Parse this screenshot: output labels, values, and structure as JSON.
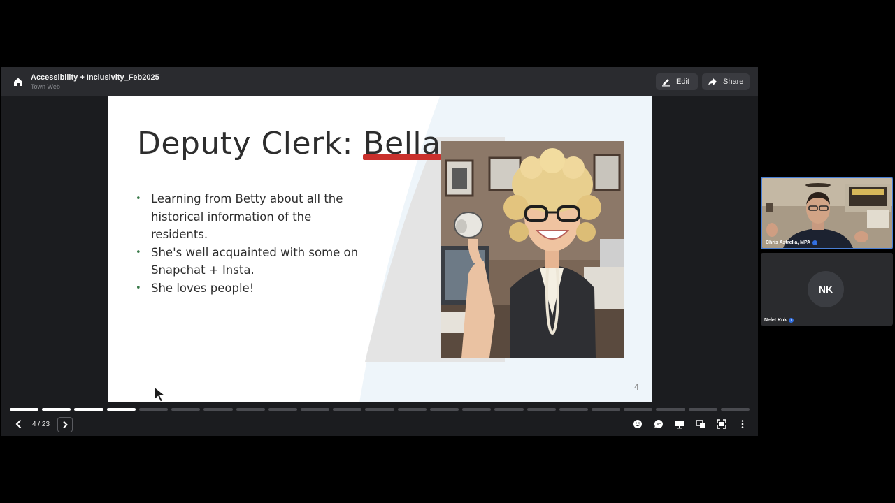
{
  "app": {
    "title": "Accessibility + Inclusivity_Feb2025",
    "subtitle": "Town Web",
    "edit_label": "Edit",
    "share_label": "Share"
  },
  "slide": {
    "title_prefix": "Deputy Clerk: ",
    "title_highlight": "Bella",
    "bullets": [
      "Learning from Betty about all the historical information of the residents.",
      "She's well acquainted with some on Snapchat + Insta.",
      "She loves people!"
    ],
    "number": "4",
    "accent_color": "#c9302c",
    "bullet_color": "#3a7a4a"
  },
  "nav": {
    "counter": "4 / 23",
    "current": 4,
    "total": 23
  },
  "controls": [
    "emoji-icon",
    "chat-icon",
    "slides-icon",
    "pip-icon",
    "fullscreen-icon",
    "more-icon"
  ],
  "participants": [
    {
      "name": "Chris Astrella, MPA",
      "active_speaker": true
    },
    {
      "name": "Nelet Kok",
      "initials": "NK",
      "active_speaker": false
    }
  ]
}
